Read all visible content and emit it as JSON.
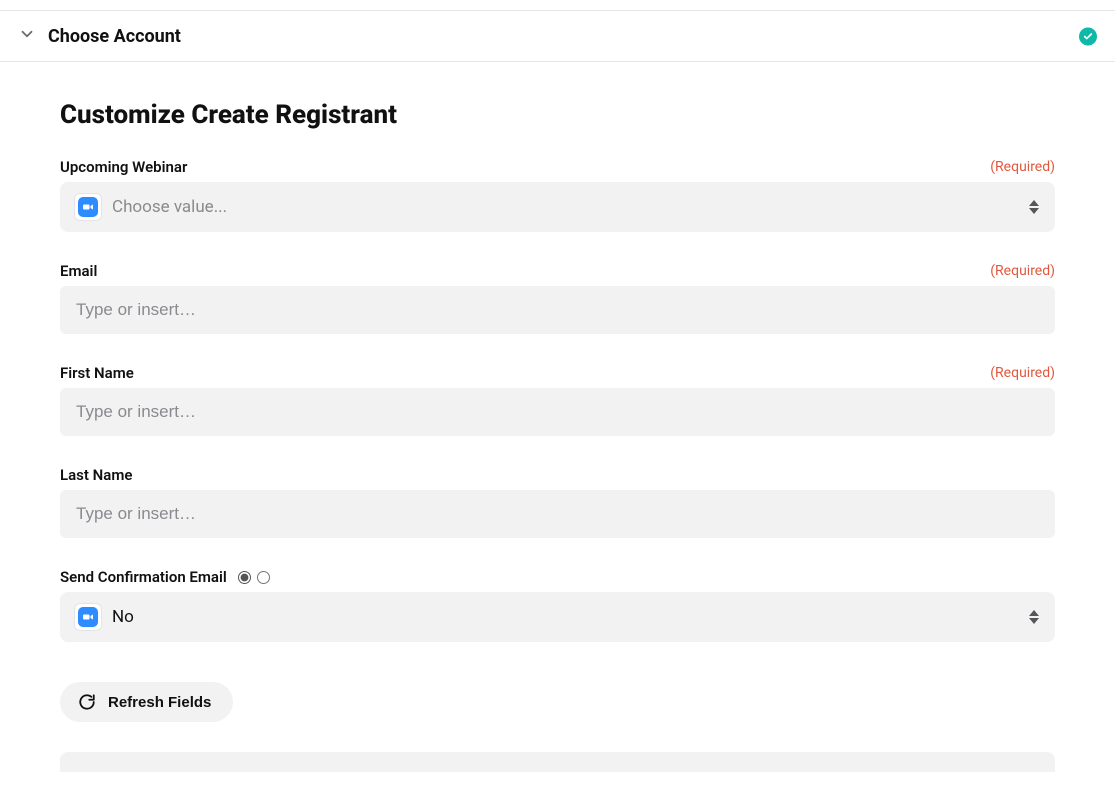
{
  "panel": {
    "title": "Choose Account"
  },
  "form": {
    "heading": "Customize Create Registrant",
    "required_text": "(Required)",
    "fields": {
      "webinar": {
        "label": "Upcoming Webinar",
        "placeholder": "Choose value...",
        "required": true
      },
      "email": {
        "label": "Email",
        "placeholder": "Type or insert…",
        "required": true
      },
      "first_name": {
        "label": "First Name",
        "placeholder": "Type or insert…",
        "required": true
      },
      "last_name": {
        "label": "Last Name",
        "placeholder": "Type or insert…",
        "required": false
      },
      "send_confirmation": {
        "label": "Send Confirmation Email",
        "value": "No"
      }
    },
    "refresh_label": "Refresh Fields"
  }
}
